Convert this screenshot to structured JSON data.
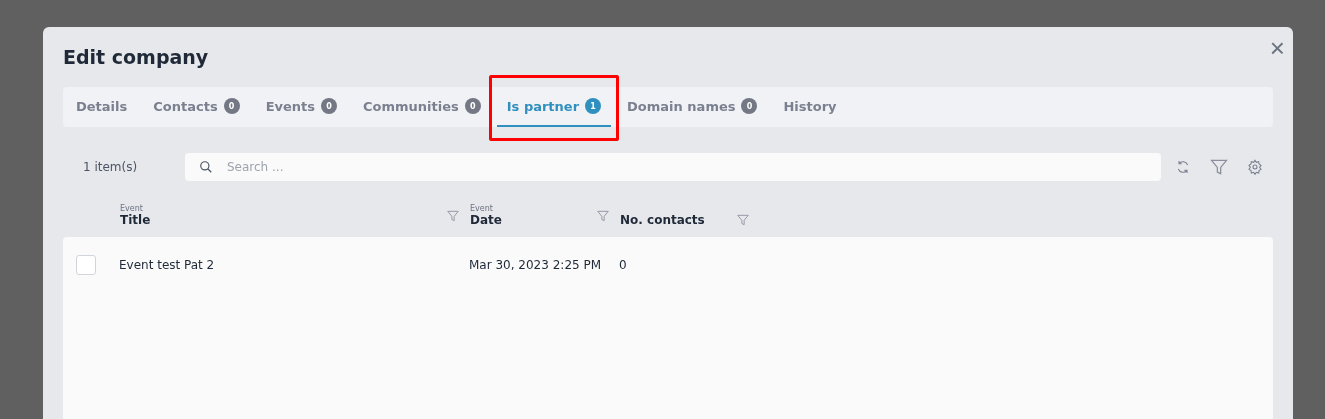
{
  "dialog": {
    "title": "Edit company",
    "close": "×"
  },
  "tabs": [
    {
      "label": "Details",
      "selected": false,
      "highlighted": false
    },
    {
      "label": "Contacts",
      "count": "0",
      "selected": false,
      "highlighted": false
    },
    {
      "label": "Events",
      "count": "0",
      "selected": false,
      "highlighted": false
    },
    {
      "label": "Communities",
      "count": "0",
      "selected": false,
      "highlighted": false
    },
    {
      "label": "Is partner",
      "count": "1",
      "selected": true,
      "highlighted": true
    },
    {
      "label": "Domain names",
      "count": "0",
      "selected": false,
      "highlighted": false
    },
    {
      "label": "History",
      "selected": false,
      "highlighted": false
    }
  ],
  "toolbar": {
    "item_count": "1 item(s)",
    "search": {
      "placeholder": "Search ..."
    }
  },
  "table": {
    "columns": [
      {
        "group": "Event",
        "label": "Title"
      },
      {
        "group": "Event",
        "label": "Date"
      },
      {
        "label": "No. contacts"
      }
    ],
    "rows": [
      {
        "checked": false,
        "cells": [
          "Event test Pat 2",
          "Mar 30, 2023 2:25 PM",
          "0"
        ]
      }
    ]
  }
}
